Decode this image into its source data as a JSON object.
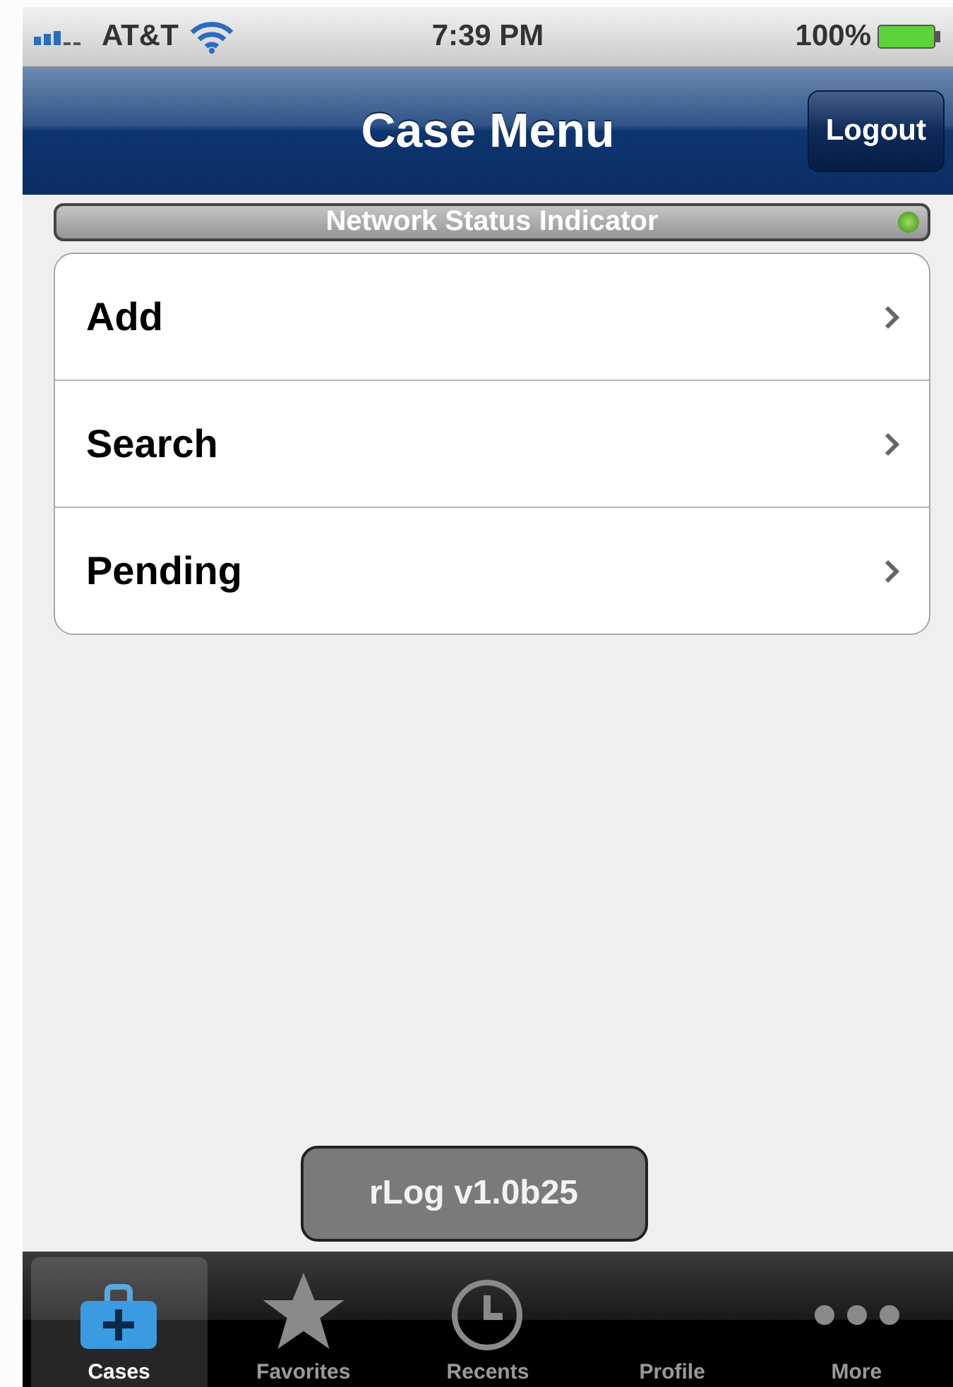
{
  "status_bar": {
    "carrier": "AT&T",
    "time": "7:39 PM",
    "battery": "100%"
  },
  "nav_bar": {
    "title": "Case Menu",
    "button": "Logout"
  },
  "network_status": {
    "label": "Network Status Indicator",
    "online": true
  },
  "menu": [
    {
      "label": "Add"
    },
    {
      "label": "Search"
    },
    {
      "label": "Pending"
    }
  ],
  "version": "rLog v1.0b25",
  "tab_bar": [
    {
      "label": "Cases",
      "kind": "case",
      "selected": true
    },
    {
      "label": "Favorites",
      "kind": "star",
      "selected": false
    },
    {
      "label": "Recents",
      "kind": "clock",
      "selected": false
    },
    {
      "label": "Profile",
      "kind": "blank",
      "selected": false
    },
    {
      "label": "More",
      "kind": "dots",
      "selected": false
    }
  ]
}
